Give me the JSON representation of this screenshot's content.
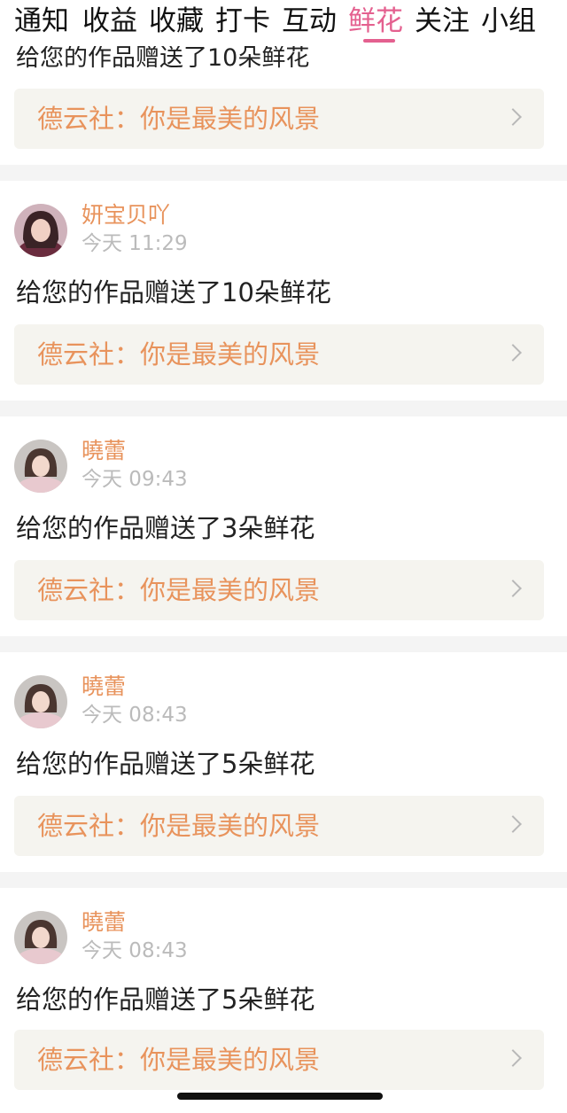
{
  "tabs": [
    {
      "label": "通知"
    },
    {
      "label": "收益"
    },
    {
      "label": "收藏"
    },
    {
      "label": "打卡"
    },
    {
      "label": "互动"
    },
    {
      "label": "鲜花"
    },
    {
      "label": "关注"
    },
    {
      "label": "小组"
    }
  ],
  "active_tab": "鲜花",
  "partial_item": {
    "message": "给您的作品赠送了10朵鲜花",
    "link": "德云社：你是最美的风景"
  },
  "items": [
    {
      "name": "妍宝贝吖",
      "time": "今天 11:29",
      "message": "给您的作品赠送了10朵鲜花",
      "link": "德云社：你是最美的风景"
    },
    {
      "name": "曉蕾",
      "time": "今天 09:43",
      "message": "给您的作品赠送了3朵鲜花",
      "link": "德云社：你是最美的风景"
    },
    {
      "name": "曉蕾",
      "time": "今天 08:43",
      "message": "给您的作品赠送了5朵鲜花",
      "link": "德云社：你是最美的风景"
    },
    {
      "name": "曉蕾",
      "time": "今天 08:43",
      "message": "给您的作品赠送了5朵鲜花",
      "link": "德云社：你是最美的风景"
    }
  ],
  "colors": {
    "accent": "#e4608f",
    "name": "#e8935c",
    "link_bg": "#f5f4ef",
    "time": "#bbbbbb"
  }
}
